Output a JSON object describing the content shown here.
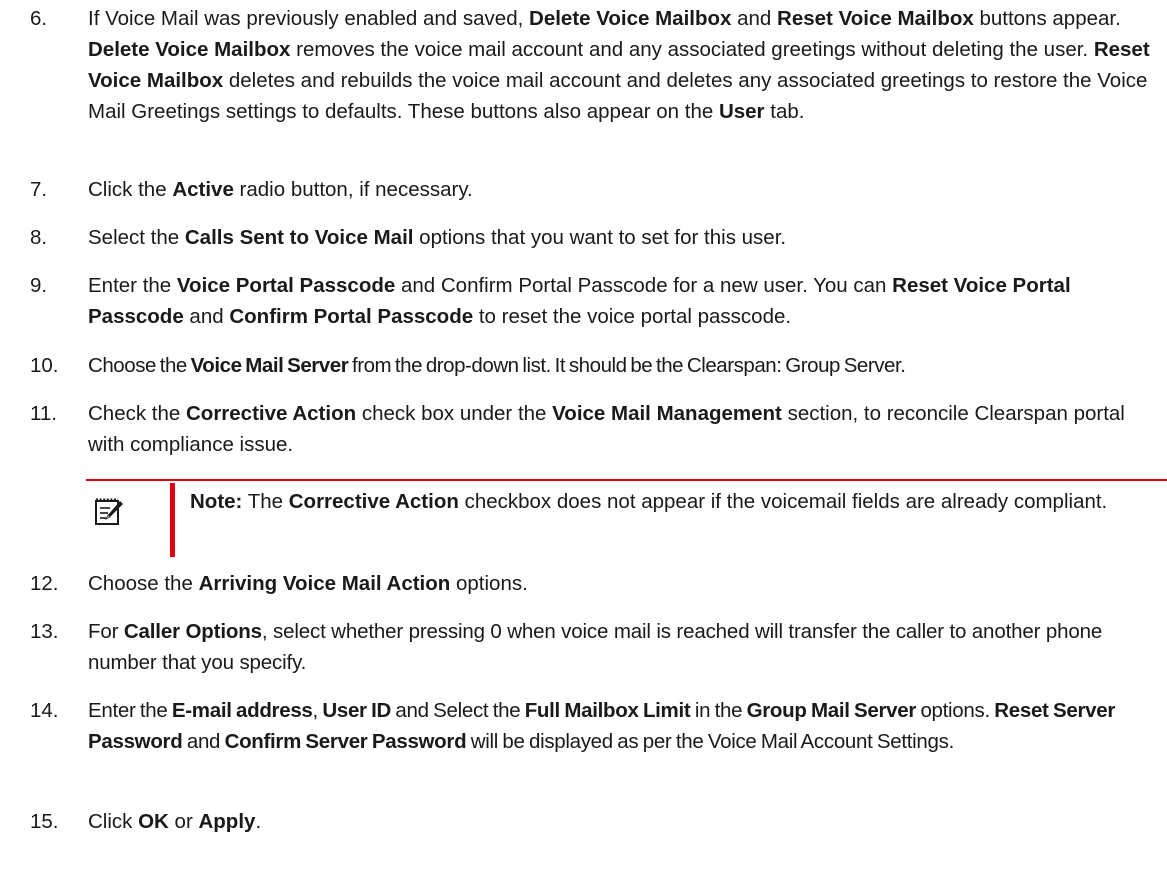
{
  "steps": [
    {
      "num": "6.",
      "parts": [
        {
          "t": "If Voice Mail was previously enabled and saved, "
        },
        {
          "t": "Delete Voice Mailbox",
          "b": true
        },
        {
          "t": " and "
        },
        {
          "t": "Reset Voice Mailbox",
          "b": true
        },
        {
          "t": " buttons appear. "
        },
        {
          "t": "Delete Voice Mailbox",
          "b": true
        },
        {
          "t": " removes the voice mail account and any associated greetings without deleting the user. "
        },
        {
          "t": "Reset Voice Mailbox",
          "b": true
        },
        {
          "t": " deletes and rebuilds the voice mail account and deletes any associated greetings to restore the Voice Mail Greetings settings to defaults. These buttons also appear on the "
        },
        {
          "t": "User",
          "b": true
        },
        {
          "t": " tab."
        }
      ]
    },
    {
      "num": "7.",
      "parts": [
        {
          "t": "Click the "
        },
        {
          "t": "Active",
          "b": true
        },
        {
          "t": " radio button, if necessary."
        }
      ]
    },
    {
      "num": "8.",
      "parts": [
        {
          "t": "Select the "
        },
        {
          "t": "Calls Sent to Voice Mail",
          "b": true
        },
        {
          "t": " options that you want to set for this user."
        }
      ]
    },
    {
      "num": "9.",
      "parts": [
        {
          "t": "Enter the "
        },
        {
          "t": "Voice Portal Passcode",
          "b": true
        },
        {
          "t": " and Confirm Portal Passcode for a new user. You can "
        },
        {
          "t": "Reset Voice Portal Passcode",
          "b": true
        },
        {
          "t": " and "
        },
        {
          "t": "Confirm Portal Passcode",
          "b": true
        },
        {
          "t": " to reset the voice portal passcode."
        }
      ]
    },
    {
      "num": "10.",
      "parts": [
        {
          "t": "Choose the "
        },
        {
          "t": "Voice Mail Server",
          "b": true
        },
        {
          "t": " from the drop-down list. It should be the Clearspan: Group Server."
        }
      ]
    },
    {
      "num": "11.",
      "parts": [
        {
          "t": "Check the "
        },
        {
          "t": "Corrective Action",
          "b": true
        },
        {
          "t": " check box under the "
        },
        {
          "t": "Voice Mail Management",
          "b": true
        },
        {
          "t": " section, to reconcile Clearspan portal with compliance issue."
        }
      ]
    },
    {
      "num": "12.",
      "parts": [
        {
          "t": "Choose the "
        },
        {
          "t": "Arriving Voice Mail Action",
          "b": true
        },
        {
          "t": " options."
        }
      ]
    },
    {
      "num": "13.",
      "parts": [
        {
          "t": "For "
        },
        {
          "t": "Caller Options",
          "b": true
        },
        {
          "t": ", select whether pressing 0 when voice mail is reached will transfer the caller to another phone number that you specify."
        }
      ]
    },
    {
      "num": "14.",
      "parts": [
        {
          "t": "Enter the "
        },
        {
          "t": "E-mail address",
          "b": true
        },
        {
          "t": ", "
        },
        {
          "t": "User ID",
          "b": true
        },
        {
          "t": " and Select the "
        },
        {
          "t": "Full Mailbox Limit",
          "b": true
        },
        {
          "t": " in the "
        },
        {
          "t": "Group Mail Server",
          "b": true
        },
        {
          "t": " options. "
        },
        {
          "t": "Reset Server Password",
          "b": true
        },
        {
          "t": " and "
        },
        {
          "t": "Confirm Server Password",
          "b": true
        },
        {
          "t": " will be displayed as per the Voice Mail Account Settings."
        }
      ]
    },
    {
      "num": "15.",
      "parts": [
        {
          "t": "Click "
        },
        {
          "t": "OK",
          "b": true
        },
        {
          "t": " or "
        },
        {
          "t": "Apply",
          "b": true
        },
        {
          "t": "."
        }
      ]
    }
  ],
  "note": {
    "icon": "note-edit-icon",
    "parts": [
      {
        "t": "Note:",
        "b": true
      },
      {
        "t": " The "
      },
      {
        "t": "Corrective Action",
        "b": true
      },
      {
        "t": " checkbox does not appear if the voicemail fields are already compliant."
      }
    ]
  },
  "colors": {
    "accent": "#e0000f",
    "text": "#1a1a1a"
  }
}
